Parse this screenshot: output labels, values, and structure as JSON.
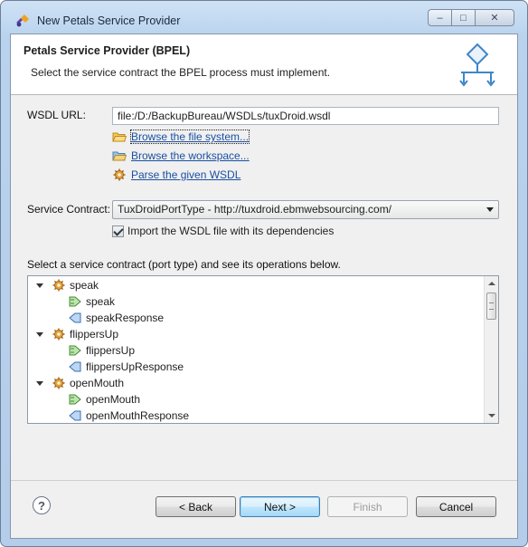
{
  "window": {
    "title": "New Petals Service Provider"
  },
  "banner": {
    "title": "Petals Service Provider (BPEL)",
    "description": "Select the service contract the BPEL process must implement."
  },
  "form": {
    "wsdl_label": "WSDL URL:",
    "wsdl_value": "file:/D:/BackupBureau/WSDLs/tuxDroid.wsdl",
    "browse_fs": "Browse the file system...",
    "browse_ws": "Browse the workspace...",
    "parse_wsdl": "Parse the given WSDL",
    "contract_label": "Service Contract:",
    "contract_value": "TuxDroidPortType - http://tuxdroid.ebmwebsourcing.com/",
    "import_label": "Import the WSDL file with its dependencies",
    "import_checked": true,
    "tree_label": "Select a service contract (port type) and see its operations below."
  },
  "tree": {
    "items": [
      {
        "label": "speak",
        "kind": "operation"
      },
      {
        "label": "speak",
        "kind": "input"
      },
      {
        "label": "speakResponse",
        "kind": "output"
      },
      {
        "label": "flippersUp",
        "kind": "operation"
      },
      {
        "label": "flippersUp",
        "kind": "input"
      },
      {
        "label": "flippersUpResponse",
        "kind": "output"
      },
      {
        "label": "openMouth",
        "kind": "operation"
      },
      {
        "label": "openMouth",
        "kind": "input"
      },
      {
        "label": "openMouthResponse",
        "kind": "output"
      }
    ]
  },
  "buttons": {
    "help": "?",
    "back": "< Back",
    "next": "Next >",
    "finish": "Finish",
    "cancel": "Cancel"
  },
  "colors": {
    "link": "#1a4fa3",
    "default_button_border": "#3c7fb1"
  }
}
